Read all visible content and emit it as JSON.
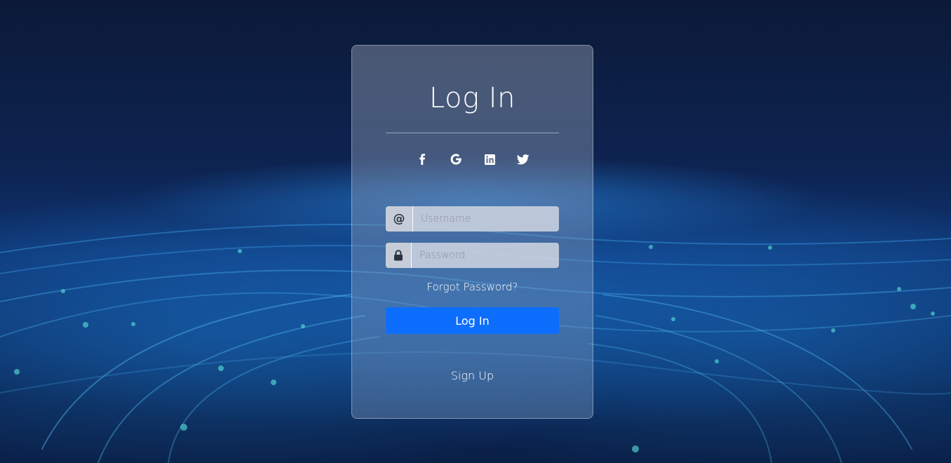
{
  "form": {
    "title": "Log In",
    "username_placeholder": "Username",
    "password_placeholder": "Password",
    "username_addon": "@",
    "forgot_password": "Forgot Password?",
    "login_button": "Log In",
    "sign_up": "Sign Up"
  },
  "social": [
    {
      "icon": "facebook-icon"
    },
    {
      "icon": "google-icon"
    },
    {
      "icon": "linkedin-icon"
    },
    {
      "icon": "twitter-icon"
    }
  ],
  "colors": {
    "primary_button": "#0d6efd",
    "text": "#ffffff"
  }
}
